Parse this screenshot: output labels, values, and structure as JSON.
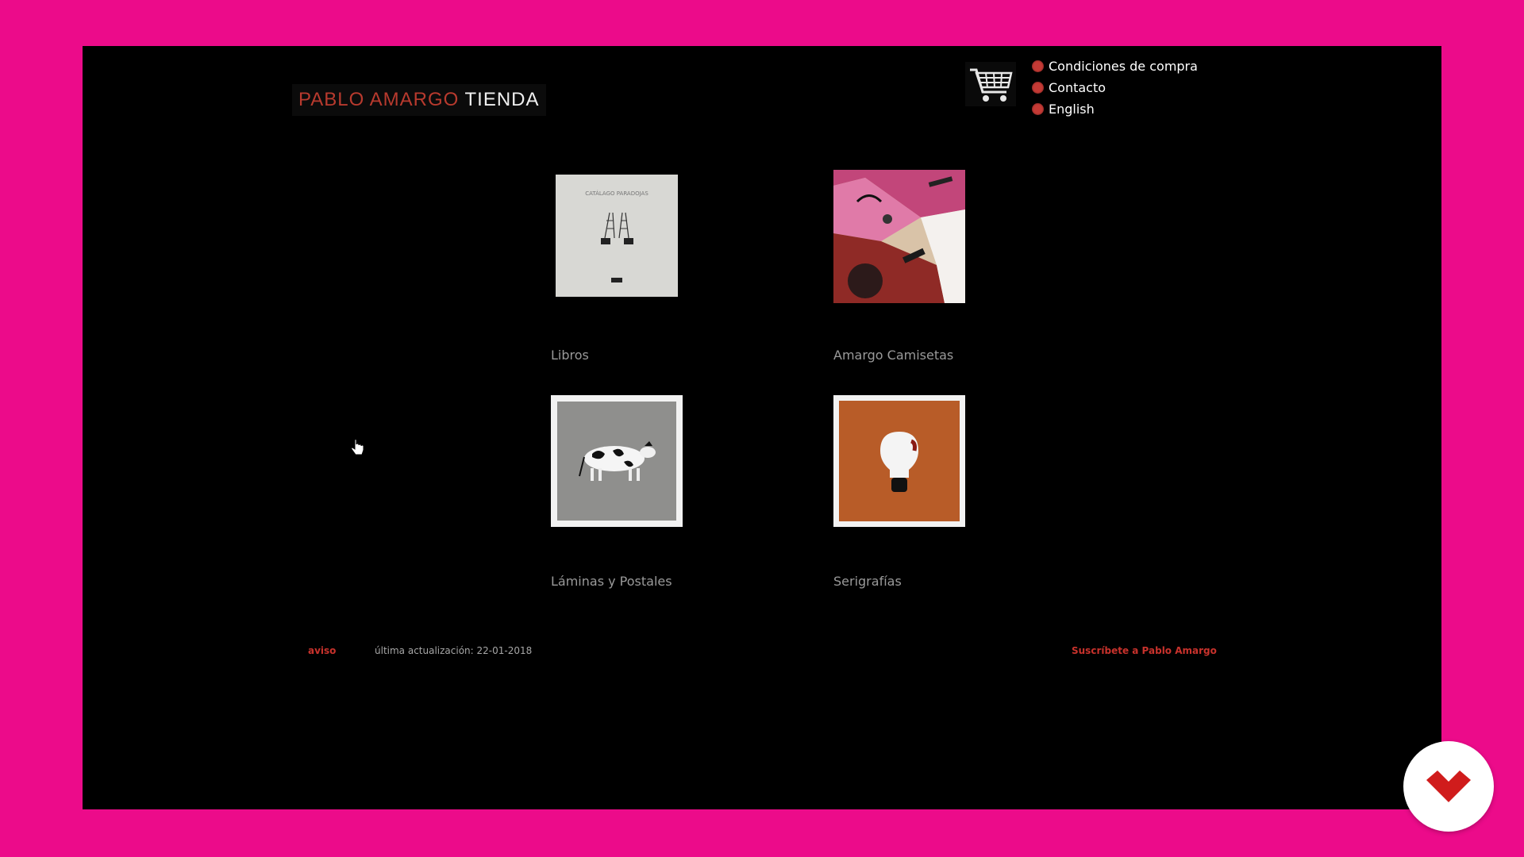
{
  "header": {
    "logo_red": "PABLO AMARGO",
    "logo_white": "TIENDA"
  },
  "nav": {
    "items": [
      "Condiciones de compra",
      "Contacto",
      "English"
    ]
  },
  "categories": [
    {
      "label": "Libros",
      "thumb_title": "CATÁLAGO PARADOJAS"
    },
    {
      "label": "Amargo Camisetas"
    },
    {
      "label": "Láminas y Postales"
    },
    {
      "label": "Serigrafías"
    }
  ],
  "footer": {
    "aviso": "aviso",
    "updated": "última actualización: 22-01-2018",
    "subscribe": "Suscríbete a Pablo Amargo"
  },
  "colors": {
    "frame": "#ec0b8a",
    "accent_red": "#c43a35",
    "background": "#000000"
  },
  "icons": [
    "shopping-cart-icon",
    "bullet-dot-icon",
    "hand-pointer-icon",
    "brand-badge-icon"
  ]
}
